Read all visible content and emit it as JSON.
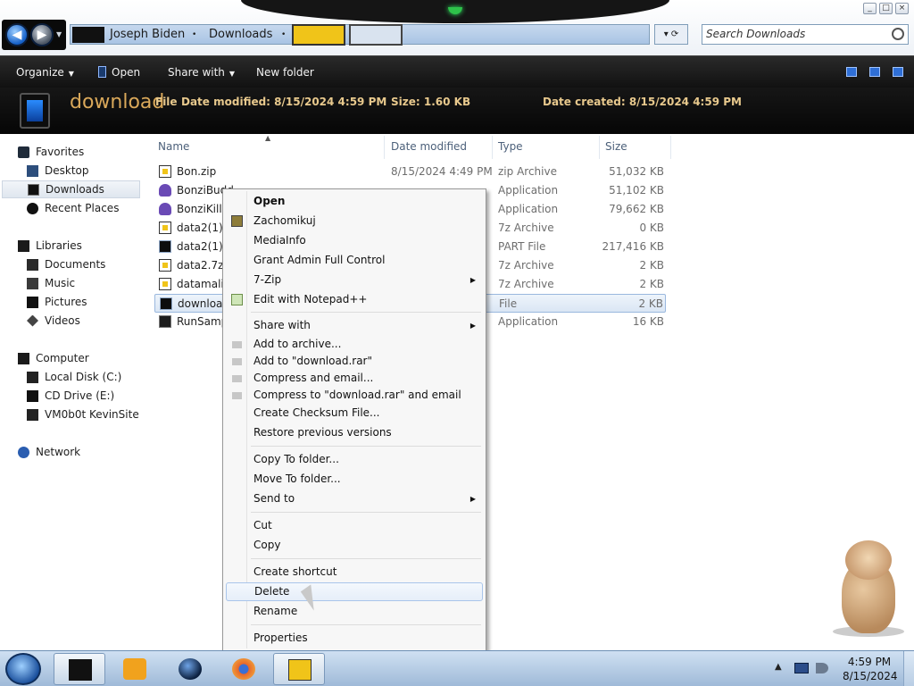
{
  "address": {
    "segments": [
      "Joseph Biden",
      "Downloads"
    ],
    "search_placeholder": "Search Downloads"
  },
  "window_controls": [
    "_",
    "□",
    "×"
  ],
  "toolbar": {
    "organize": "Organize",
    "open": "Open",
    "share_with": "Share with",
    "new_folder": "New folder"
  },
  "details": {
    "name": "download",
    "type": "File",
    "date_modified": "Date modified: 8/15/2024 4:59 PM",
    "size": "Size: 1.60 KB",
    "date_created": "Date created: 8/15/2024 4:59 PM"
  },
  "nav": {
    "favorites": "Favorites",
    "desktop": "Desktop",
    "downloads": "Downloads",
    "recent": "Recent Places",
    "libraries": "Libraries",
    "documents": "Documents",
    "music": "Music",
    "pictures": "Pictures",
    "videos": "Videos",
    "computer": "Computer",
    "local_disk": "Local Disk (C:)",
    "cd_drive": "CD Drive (E:)",
    "vm": "VM0b0t KevinSite",
    "network": "Network"
  },
  "columns": {
    "name": "Name",
    "date": "Date modified",
    "type": "Type",
    "size": "Size"
  },
  "files": [
    {
      "name": "Bon.zip",
      "date": "8/15/2024 4:49 PM",
      "type": "zip Archive",
      "size": "51,032 KB",
      "icon": "zip-file-icon"
    },
    {
      "name": "BonziBudd...",
      "date": "",
      "type": "Application",
      "size": "51,102 KB",
      "icon": "bonzi-app-icon"
    },
    {
      "name": "BonziKill.e...",
      "date": "",
      "type": "Application",
      "size": "79,662 KB",
      "icon": "bonzi-app-icon"
    },
    {
      "name": "data2(1).7...",
      "date": "",
      "type": "7z Archive",
      "size": "0 KB",
      "icon": "7z-file-icon"
    },
    {
      "name": "data2(1).r...",
      "date": "",
      "type": "PART File",
      "size": "217,416 KB",
      "icon": "generic-file-icon"
    },
    {
      "name": "data2.7z",
      "date": "",
      "type": "7z Archive",
      "size": "2 KB",
      "icon": "7z-file-icon"
    },
    {
      "name": "datamalic...",
      "date": "",
      "type": "7z Archive",
      "size": "2 KB",
      "icon": "7z-file-icon"
    },
    {
      "name": "download",
      "date": "",
      "type": "File",
      "size": "2 KB",
      "icon": "generic-file-icon"
    },
    {
      "name": "RunSamp...",
      "date": "",
      "type": "Application",
      "size": "16 KB",
      "icon": "exe-file-icon"
    }
  ],
  "context_menu": {
    "open": "Open",
    "zachomikuj": "Zachomikuj",
    "mediainfo": "MediaInfo",
    "grant_admin": "Grant Admin Full Control",
    "seven_zip": "7-Zip",
    "notepadpp": "Edit with Notepad++",
    "share_with": "Share with",
    "add_archive": "Add to archive...",
    "add_rar": "Add to \"download.rar\"",
    "compress_email": "Compress and email...",
    "compress_rar_email": "Compress to \"download.rar\" and email",
    "checksum": "Create Checksum File...",
    "restore": "Restore previous versions",
    "copy_to": "Copy To folder...",
    "move_to": "Move To folder...",
    "send_to": "Send to",
    "cut": "Cut",
    "copy": "Copy",
    "create_shortcut": "Create shortcut",
    "delete": "Delete",
    "rename": "Rename",
    "properties": "Properties"
  },
  "taskbar": {
    "time": "4:59 PM",
    "date": "8/15/2024"
  }
}
